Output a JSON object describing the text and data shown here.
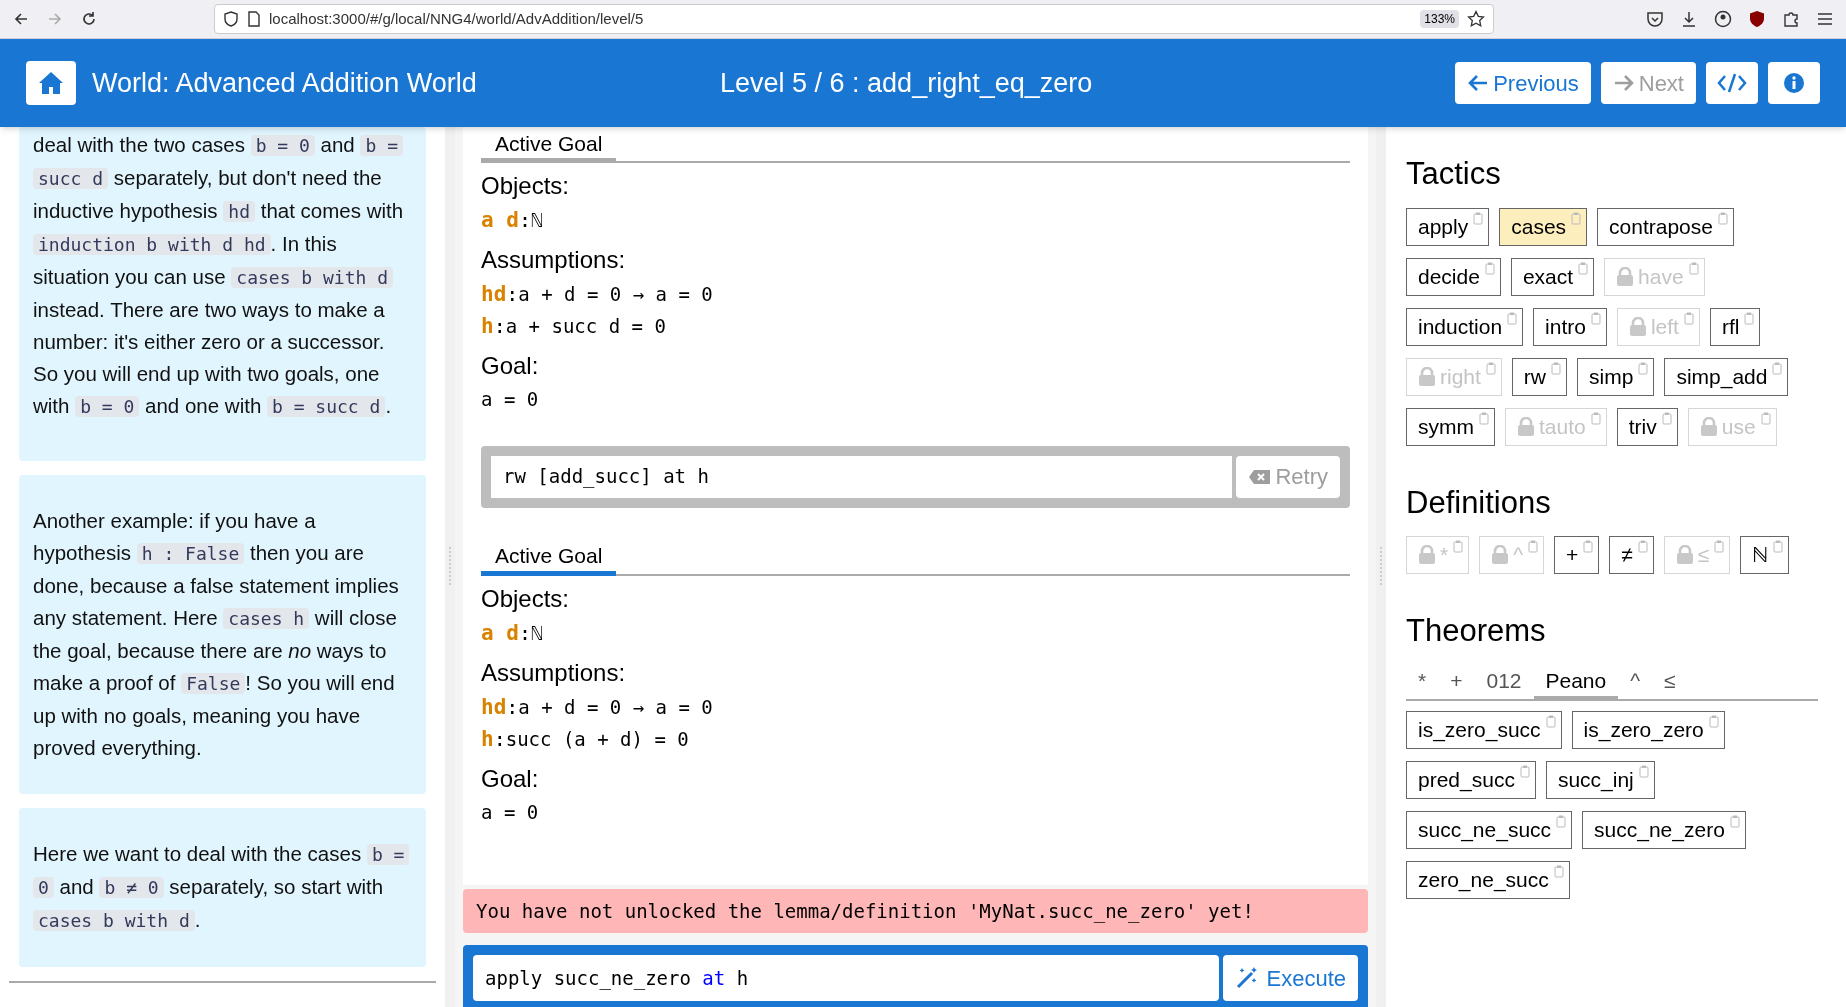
{
  "browser": {
    "url": "localhost:3000/#/g/local/NNG4/world/AdvAddition/level/5",
    "zoom": "133%"
  },
  "header": {
    "world_title": "World: Advanced Addition World",
    "level_title": "Level 5 / 6 : add_right_eq_zero",
    "previous": {
      "label": "Previous",
      "disabled": false
    },
    "next": {
      "label": "Next",
      "disabled": true
    }
  },
  "hints": [
    {
      "segments": [
        {
          "kind": "text",
          "text": "deal with the two cases "
        },
        {
          "kind": "code",
          "text": "b = 0"
        },
        {
          "kind": "text",
          "text": " and "
        },
        {
          "kind": "code",
          "text": "b = succ d"
        },
        {
          "kind": "text",
          "text": " separately, but don't need the inductive hypothesis "
        },
        {
          "kind": "code",
          "text": "hd"
        },
        {
          "kind": "text",
          "text": " that comes with "
        },
        {
          "kind": "code",
          "text": "induction b with d hd"
        },
        {
          "kind": "text",
          "text": ". In this situation you can use "
        },
        {
          "kind": "code",
          "text": "cases b with d"
        },
        {
          "kind": "text",
          "text": " instead. There are two ways to make a number: it's either zero or a successor. So you will end up with two goals, one with "
        },
        {
          "kind": "code",
          "text": "b = 0"
        },
        {
          "kind": "text",
          "text": " and one with "
        },
        {
          "kind": "code",
          "text": "b = succ d"
        },
        {
          "kind": "text",
          "text": "."
        }
      ]
    },
    {
      "segments": [
        {
          "kind": "text",
          "text": "Another example: if you have a hypothesis "
        },
        {
          "kind": "code",
          "text": "h : False"
        },
        {
          "kind": "text",
          "text": " then you are done, because a false statement implies any statement. Here "
        },
        {
          "kind": "code",
          "text": "cases h"
        },
        {
          "kind": "text",
          "text": " will close the goal, because there are *no* ways to make a proof of "
        },
        {
          "kind": "code",
          "text": "False"
        },
        {
          "kind": "text",
          "text": "! So you will end up with no goals, meaning you have proved everything."
        }
      ]
    },
    {
      "segments": [
        {
          "kind": "text",
          "text": "Here we want to deal with the cases "
        },
        {
          "kind": "code",
          "text": "b = 0"
        },
        {
          "kind": "text",
          "text": " and "
        },
        {
          "kind": "code",
          "text": "b ≠ 0"
        },
        {
          "kind": "text",
          "text": " separately, so start with "
        },
        {
          "kind": "code",
          "text": "cases b with d"
        },
        {
          "kind": "text",
          "text": "."
        }
      ]
    }
  ],
  "steps": [
    {
      "tab": {
        "label": "Active Goal",
        "selected": false
      },
      "objects_heading": "Objects:",
      "objects": [
        {
          "names": "a d",
          "separator": ":",
          "type": "ℕ"
        }
      ],
      "assumptions_heading": "Assumptions:",
      "assumptions": [
        {
          "name": "hd",
          "separator": ":",
          "type": "a + d = 0 → a = 0"
        },
        {
          "name": "h",
          "separator": ":",
          "type": "a + succ d = 0"
        }
      ],
      "goal_heading": "Goal:",
      "goal": "a = 0",
      "command": "rw [add_succ] at h",
      "retry": "Retry"
    },
    {
      "tab": {
        "label": "Active Goal",
        "selected": true
      },
      "objects_heading": "Objects:",
      "objects": [
        {
          "names": "a d",
          "separator": ":",
          "type": "ℕ"
        }
      ],
      "assumptions_heading": "Assumptions:",
      "assumptions": [
        {
          "name": "hd",
          "separator": ":",
          "type": "a + d = 0 → a = 0"
        },
        {
          "name": "h",
          "separator": ":",
          "type": "succ (a + d) = 0"
        }
      ],
      "goal_heading": "Goal:",
      "goal": "a = 0"
    }
  ],
  "error": "You have not unlocked the lemma/definition 'MyNat.succ_ne_zero' yet!",
  "input": {
    "segments": [
      {
        "kind": "plain",
        "text": "apply succ_ne_zero "
      },
      {
        "kind": "keyword",
        "text": "at"
      },
      {
        "kind": "plain",
        "text": " h"
      }
    ],
    "execute": "Execute"
  },
  "tactics": {
    "title": "Tactics",
    "items": [
      {
        "label": "apply",
        "locked": false,
        "highlighted": false
      },
      {
        "label": "cases",
        "locked": false,
        "highlighted": true
      },
      {
        "label": "contrapose",
        "locked": false,
        "highlighted": false
      },
      {
        "label": "decide",
        "locked": false,
        "highlighted": false
      },
      {
        "label": "exact",
        "locked": false,
        "highlighted": false
      },
      {
        "label": "have",
        "locked": true,
        "highlighted": false
      },
      {
        "label": "induction",
        "locked": false,
        "highlighted": false
      },
      {
        "label": "intro",
        "locked": false,
        "highlighted": false
      },
      {
        "label": "left",
        "locked": true,
        "highlighted": false
      },
      {
        "label": "rfl",
        "locked": false,
        "highlighted": false
      },
      {
        "label": "right",
        "locked": true,
        "highlighted": false
      },
      {
        "label": "rw",
        "locked": false,
        "highlighted": false
      },
      {
        "label": "simp",
        "locked": false,
        "highlighted": false
      },
      {
        "label": "simp_add",
        "locked": false,
        "highlighted": false
      },
      {
        "label": "symm",
        "locked": false,
        "highlighted": false
      },
      {
        "label": "tauto",
        "locked": true,
        "highlighted": false
      },
      {
        "label": "triv",
        "locked": false,
        "highlighted": false
      },
      {
        "label": "use",
        "locked": true,
        "highlighted": false
      }
    ]
  },
  "definitions": {
    "title": "Definitions",
    "items": [
      {
        "label": "*",
        "locked": true,
        "highlighted": false
      },
      {
        "label": "^",
        "locked": true,
        "highlighted": false
      },
      {
        "label": "+",
        "locked": false,
        "highlighted": false
      },
      {
        "label": "≠",
        "locked": false,
        "highlighted": false
      },
      {
        "label": "≤",
        "locked": true,
        "highlighted": false
      },
      {
        "label": "ℕ",
        "locked": false,
        "highlighted": false
      }
    ]
  },
  "theorems": {
    "title": "Theorems",
    "tabs": [
      {
        "label": "*",
        "selected": false
      },
      {
        "label": "+",
        "selected": false
      },
      {
        "label": "012",
        "selected": false
      },
      {
        "label": "Peano",
        "selected": true
      },
      {
        "label": "^",
        "selected": false
      },
      {
        "label": "≤",
        "selected": false
      }
    ],
    "items": [
      {
        "label": "is_zero_succ",
        "locked": false,
        "highlighted": false
      },
      {
        "label": "is_zero_zero",
        "locked": false,
        "highlighted": false
      },
      {
        "label": "pred_succ",
        "locked": false,
        "highlighted": false
      },
      {
        "label": "succ_inj",
        "locked": false,
        "highlighted": false
      },
      {
        "label": "succ_ne_succ",
        "locked": false,
        "highlighted": false
      },
      {
        "label": "succ_ne_zero",
        "locked": false,
        "highlighted": false
      },
      {
        "label": "zero_ne_succ",
        "locked": false,
        "highlighted": false
      }
    ]
  }
}
